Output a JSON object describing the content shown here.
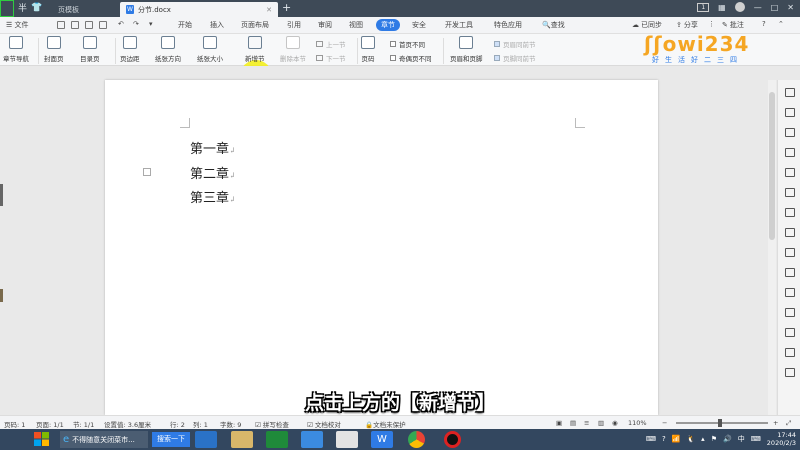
{
  "tabbar": {
    "template_tab": "页模板",
    "doc_tab": "分节.docx",
    "page_badge": "1",
    "window_min": "—",
    "window_max": "□",
    "window_close": "✕"
  },
  "menubar": {
    "file": "文件",
    "items": [
      "开始",
      "插入",
      "页面布局",
      "引用",
      "审阅",
      "视图",
      "章节",
      "安全",
      "开发工具",
      "特色应用"
    ],
    "active": "章节",
    "search": "查找",
    "sync": "已同步",
    "share": "分享",
    "annotate": "批注"
  },
  "ribbon": {
    "nav": "章节导航",
    "cover": "封面页",
    "toc": "目录页",
    "margins": "页边距",
    "orientation": "纸张方向",
    "size": "纸张大小",
    "new_section": "新增节",
    "delete_section": "删除本节",
    "prev_section": "上一节",
    "next_section": "下一节",
    "page_number": "页码",
    "first_page_diff": "首页不同",
    "odd_even_diff": "奇偶页不同",
    "header_footer": "页眉和页脚",
    "header_same_prev": "页眉同前节",
    "footer_same_prev": "页脚同前节"
  },
  "logo": {
    "main": "ʃʃowi234",
    "sub": "好生活好二三四"
  },
  "document": {
    "lines": [
      "第一章",
      "第二章",
      "第三章"
    ]
  },
  "subtitle": "点击上方的【新增节】",
  "statusbar": {
    "page": "页码: 1",
    "pages": "页面: 1/1",
    "section": "节: 1/1",
    "setting": "设置值: 3.6厘米",
    "row": "行: 2",
    "col": "列: 1",
    "words": "字数: 9",
    "spell": "拼写检查",
    "doc_check": "文档校对",
    "protect": "文档未保护",
    "zoom": "110%"
  },
  "taskbar": {
    "ie_task": "不得随意关闭菜市...",
    "search": "搜索一下",
    "time": "17:44",
    "date": "2020/2/3",
    "ime": "中"
  },
  "colors": {
    "accent": "#2f7be5",
    "highlight": "#f2ee12",
    "logo_orange": "#f5a623"
  }
}
